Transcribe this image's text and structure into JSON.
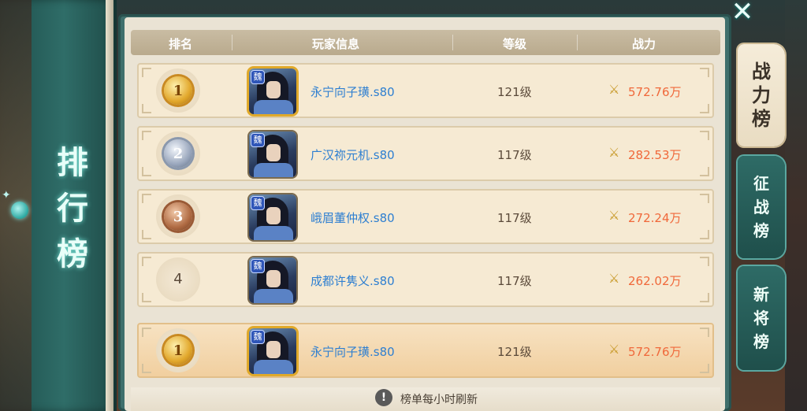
{
  "banner": {
    "title_chars": [
      "排",
      "行",
      "榜"
    ]
  },
  "close_label": "✕",
  "header": {
    "rank": "排名",
    "player": "玩家信息",
    "level": "等级",
    "power": "战力"
  },
  "rows": [
    {
      "rank": "1",
      "name": "永宁向子璜.s80",
      "level": "121级",
      "power": "572.76万",
      "badge": "魏"
    },
    {
      "rank": "2",
      "name": "广汉祢元机.s80",
      "level": "117级",
      "power": "282.53万",
      "badge": "魏"
    },
    {
      "rank": "3",
      "name": "峨眉董仲权.s80",
      "level": "117级",
      "power": "272.24万",
      "badge": "魏"
    },
    {
      "rank": "4",
      "name": "成都许隽义.s80",
      "level": "117级",
      "power": "262.02万",
      "badge": "魏"
    },
    {
      "rank": "1",
      "name": "永宁向子璜.s80",
      "level": "121级",
      "power": "572.76万",
      "badge": "魏"
    }
  ],
  "footer": {
    "info_icon": "!",
    "text": "榜单每小时刷新"
  },
  "tabs": [
    {
      "chars": [
        "战",
        "力",
        "榜"
      ]
    },
    {
      "chars": [
        "征",
        "战",
        "榜"
      ]
    },
    {
      "chars": [
        "新",
        "将",
        "榜"
      ]
    }
  ],
  "icons": {
    "power": "crossed-swords-icon",
    "medal_1": "gold-medal-icon",
    "medal_2": "silver-medal-icon",
    "medal_3": "bronze-medal-icon"
  },
  "colors": {
    "name_blue": "#2e7fd1",
    "power_orange": "#f0683a",
    "board_teal": "#3f6f6c"
  }
}
